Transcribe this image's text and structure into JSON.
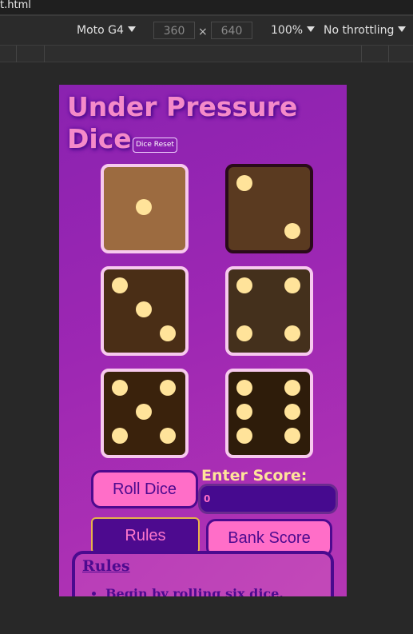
{
  "browser": {
    "file_name": "t.html"
  },
  "devtools": {
    "device": "Moto G4",
    "width": "360",
    "height": "640",
    "zoom": "100%",
    "throttling": "No throttling"
  },
  "app": {
    "title": "Under Pressure Dice",
    "reset_label": "Dice Reset",
    "dice": [
      {
        "value": 1,
        "color": "#9c6b40",
        "selected": false
      },
      {
        "value": 2,
        "color": "#5a3a20",
        "selected": true
      },
      {
        "value": 3,
        "color": "#4a2e16",
        "selected": false
      },
      {
        "value": 4,
        "color": "#44301c",
        "selected": false
      },
      {
        "value": 5,
        "color": "#3a220c",
        "selected": false
      },
      {
        "value": 6,
        "color": "#2e1c0a",
        "selected": false
      }
    ],
    "roll_label": "Roll Dice",
    "enter_score_label": "Enter Score:",
    "score_value": "0",
    "rules_button_label": "Rules",
    "bank_label": "Bank Score",
    "rules": {
      "title": "Rules",
      "items": [
        "Begin by rolling six dice."
      ]
    },
    "colors": {
      "pip": "#ffe39a",
      "accent_pink": "#ff6ec8",
      "deep_purple": "#4d0a8f"
    }
  }
}
